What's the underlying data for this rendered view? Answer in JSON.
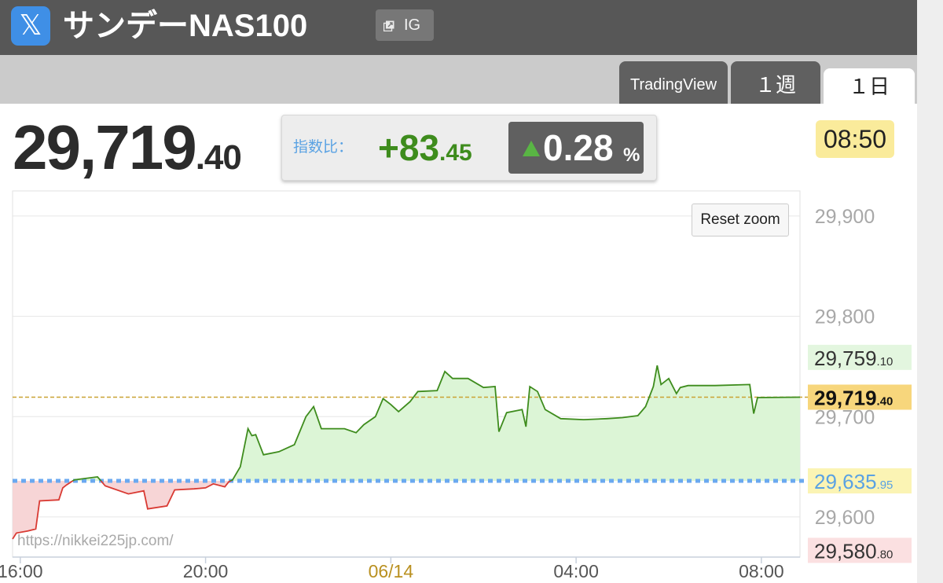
{
  "header": {
    "logo_glyph": "𝕏",
    "title": "サンデーNAS100",
    "source_badge": "IG"
  },
  "tabs": [
    {
      "label": "TradingView",
      "active": false
    },
    {
      "label": "１週",
      "active": false
    },
    {
      "label": "１日",
      "active": true
    }
  ],
  "quote": {
    "price_int": "29,719",
    "price_dec": ".40",
    "change_label": "指数比：",
    "change_int": "+83",
    "change_dec": ".45",
    "change_pct": "0.28",
    "change_pct_unit": "%",
    "time": "08:50"
  },
  "controls": {
    "reset_zoom": "Reset zoom"
  },
  "watermark": "https://nikkei225jp.com/",
  "colors": {
    "up": "#3e8c1d",
    "up_fill": "#dcf5d6",
    "down": "#d93a33",
    "down_fill": "#f7d5d6",
    "reference": "#6ba9f0",
    "current": "#c9a233",
    "date_label": "#b99020"
  },
  "chart_data": {
    "type": "line",
    "y_range": [
      29560,
      29925
    ],
    "gridlines": [
      29600,
      29700,
      29800,
      29900
    ],
    "y_ticks": [
      {
        "value": 29900,
        "text": "29,900"
      },
      {
        "value": 29800,
        "text": "29,800"
      },
      {
        "value": 29700,
        "text": "29,700"
      },
      {
        "value": 29600,
        "text": "29,600"
      }
    ],
    "x_range": [
      "15:50",
      "08:50"
    ],
    "x_ticks": [
      {
        "time": "16:00",
        "text": "16:00",
        "is_date": false
      },
      {
        "time": "20:00",
        "text": "20:00",
        "is_date": false
      },
      {
        "time": "00:00",
        "text": "06/14",
        "is_date": true
      },
      {
        "time": "04:00",
        "text": "04:00",
        "is_date": false
      },
      {
        "time": "08:00",
        "text": "08:00",
        "is_date": false
      }
    ],
    "reference_value": 29635.95,
    "current_value": 29719.4,
    "labels": [
      {
        "role": "high",
        "value": 29759.1,
        "int": "29,759",
        "dec": ".10",
        "bg": "#e3f6df",
        "fg": "#333333"
      },
      {
        "role": "current",
        "value": 29719.4,
        "int": "29,719",
        "dec": ".40",
        "bg": "#f7d67c",
        "fg": "#111111"
      },
      {
        "role": "reference",
        "value": 29635.95,
        "int": "29,635",
        "dec": ".95",
        "bg": "#fbf4b4",
        "fg": "#5aa2e3"
      },
      {
        "role": "low",
        "value": 29580.8,
        "int": "29,580",
        "dec": ".80",
        "bg": "#fbe0e1",
        "fg": "#333333"
      }
    ],
    "series": [
      {
        "time": "15:50",
        "value": 29578
      },
      {
        "time": "15:55",
        "value": 29584
      },
      {
        "time": "16:10",
        "value": 29586
      },
      {
        "time": "16:20",
        "value": 29588
      },
      {
        "time": "16:25",
        "value": 29616
      },
      {
        "time": "16:50",
        "value": 29617
      },
      {
        "time": "16:55",
        "value": 29629
      },
      {
        "time": "17:00",
        "value": 29632
      },
      {
        "time": "17:10",
        "value": 29637
      },
      {
        "time": "17:40",
        "value": 29640
      },
      {
        "time": "17:50",
        "value": 29631
      },
      {
        "time": "18:20",
        "value": 29623
      },
      {
        "time": "18:40",
        "value": 29626
      },
      {
        "time": "18:45",
        "value": 29608
      },
      {
        "time": "19:10",
        "value": 29611
      },
      {
        "time": "19:20",
        "value": 29627
      },
      {
        "time": "19:45",
        "value": 29628
      },
      {
        "time": "20:00",
        "value": 29629
      },
      {
        "time": "20:10",
        "value": 29633
      },
      {
        "time": "20:25",
        "value": 29630
      },
      {
        "time": "20:30",
        "value": 29635
      },
      {
        "time": "20:35",
        "value": 29637
      },
      {
        "time": "20:45",
        "value": 29650
      },
      {
        "time": "20:55",
        "value": 29688
      },
      {
        "time": "21:00",
        "value": 29681
      },
      {
        "time": "21:05",
        "value": 29682
      },
      {
        "time": "21:15",
        "value": 29662
      },
      {
        "time": "21:35",
        "value": 29665
      },
      {
        "time": "21:55",
        "value": 29672
      },
      {
        "time": "22:10",
        "value": 29700
      },
      {
        "time": "22:20",
        "value": 29710
      },
      {
        "time": "22:30",
        "value": 29688
      },
      {
        "time": "23:00",
        "value": 29688
      },
      {
        "time": "23:15",
        "value": 29684
      },
      {
        "time": "23:25",
        "value": 29692
      },
      {
        "time": "23:40",
        "value": 29700
      },
      {
        "time": "23:50",
        "value": 29718
      },
      {
        "time": "00:00",
        "value": 29712
      },
      {
        "time": "00:10",
        "value": 29705
      },
      {
        "time": "00:25",
        "value": 29715
      },
      {
        "time": "00:35",
        "value": 29725
      },
      {
        "time": "01:00",
        "value": 29726
      },
      {
        "time": "01:10",
        "value": 29745
      },
      {
        "time": "01:20",
        "value": 29738
      },
      {
        "time": "01:40",
        "value": 29738
      },
      {
        "time": "02:00",
        "value": 29729
      },
      {
        "time": "02:15",
        "value": 29730
      },
      {
        "time": "02:20",
        "value": 29685
      },
      {
        "time": "02:30",
        "value": 29704
      },
      {
        "time": "02:50",
        "value": 29707
      },
      {
        "time": "02:55",
        "value": 29690
      },
      {
        "time": "03:00",
        "value": 29730
      },
      {
        "time": "03:10",
        "value": 29725
      },
      {
        "time": "03:20",
        "value": 29707
      },
      {
        "time": "03:40",
        "value": 29698
      },
      {
        "time": "04:10",
        "value": 29697
      },
      {
        "time": "04:40",
        "value": 29698
      },
      {
        "time": "05:00",
        "value": 29699
      },
      {
        "time": "05:20",
        "value": 29701
      },
      {
        "time": "05:30",
        "value": 29710
      },
      {
        "time": "05:40",
        "value": 29730
      },
      {
        "time": "05:45",
        "value": 29751
      },
      {
        "time": "05:50",
        "value": 29732
      },
      {
        "time": "06:00",
        "value": 29738
      },
      {
        "time": "06:10",
        "value": 29723
      },
      {
        "time": "06:15",
        "value": 29729
      },
      {
        "time": "06:25",
        "value": 29731
      },
      {
        "time": "07:00",
        "value": 29731
      },
      {
        "time": "07:45",
        "value": 29732
      },
      {
        "time": "07:50",
        "value": 29703
      },
      {
        "time": "07:55",
        "value": 29719
      },
      {
        "time": "08:50",
        "value": 29719.4
      }
    ]
  }
}
